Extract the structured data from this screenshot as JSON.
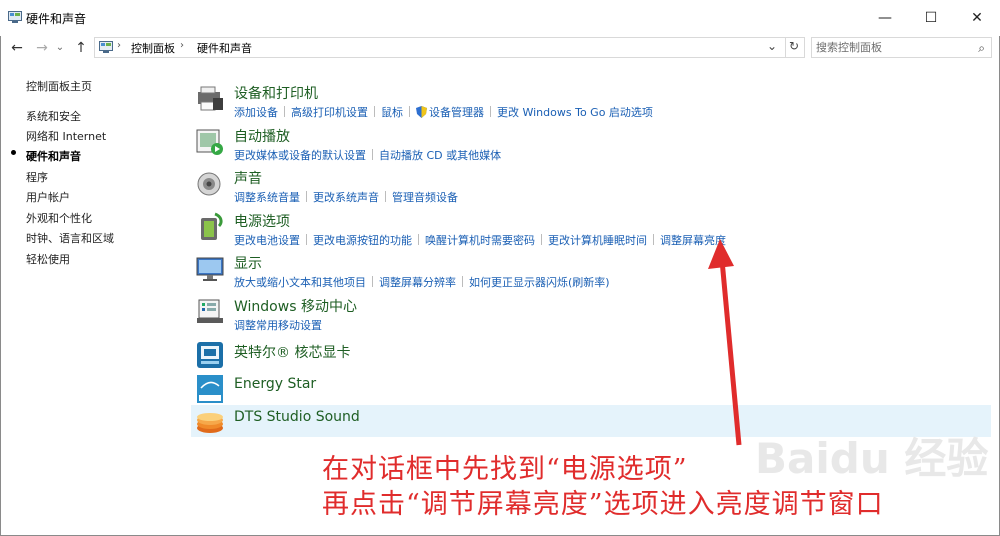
{
  "window": {
    "title": "硬件和声音",
    "minimize": "—",
    "maximize": "☐",
    "close": "✕"
  },
  "nav": {
    "back": "←",
    "forward": "→",
    "recent": "⌄",
    "up": "↑",
    "dropdown": "⌄",
    "refresh": "↻"
  },
  "breadcrumb": [
    "控制面板",
    "硬件和声音"
  ],
  "search": {
    "placeholder": "搜索控制面板",
    "icon": "⌕"
  },
  "sidebar": {
    "items": [
      "控制面板主页",
      "系统和安全",
      "网络和 Internet",
      "硬件和声音",
      "程序",
      "用户帐户",
      "外观和个性化",
      "时钟、语言和区域",
      "轻松使用"
    ],
    "active_index": 3
  },
  "categories": [
    {
      "title": "设备和打印机",
      "links": [
        "添加设备",
        "高级打印机设置",
        "鼠标",
        "设备管理器",
        "更改 Windows To Go 启动选项"
      ],
      "icon": "printer-icon"
    },
    {
      "title": "自动播放",
      "links": [
        "更改媒体或设备的默认设置",
        "自动播放 CD 或其他媒体"
      ],
      "icon": "autoplay-icon"
    },
    {
      "title": "声音",
      "links": [
        "调整系统音量",
        "更改系统声音",
        "管理音频设备"
      ],
      "icon": "speaker-icon"
    },
    {
      "title": "电源选项",
      "links": [
        "更改电池设置",
        "更改电源按钮的功能",
        "唤醒计算机时需要密码",
        "更改计算机睡眠时间",
        "调整屏幕亮度"
      ],
      "icon": "power-icon"
    },
    {
      "title": "显示",
      "links": [
        "放大或缩小文本和其他项目",
        "调整屏幕分辨率",
        "如何更正显示器闪烁(刷新率)"
      ],
      "icon": "monitor-icon"
    },
    {
      "title": "Windows 移动中心",
      "links": [
        "调整常用移动设置"
      ],
      "icon": "mobility-center-icon"
    },
    {
      "title": "英特尔® 核芯显卡",
      "links": [],
      "icon": "intel-graphics-icon"
    },
    {
      "title": "Energy Star",
      "links": [],
      "icon": "energy-star-icon"
    },
    {
      "title": "DTS Studio Sound",
      "links": [],
      "icon": "dts-sound-icon"
    }
  ],
  "annotation": {
    "line1": "在对话框中先找到“电源选项”",
    "line2": "再点击“调节屏幕亮度”选项进入亮度调节窗口",
    "color": "#e02c2c"
  },
  "watermark": "Baidu 经验"
}
